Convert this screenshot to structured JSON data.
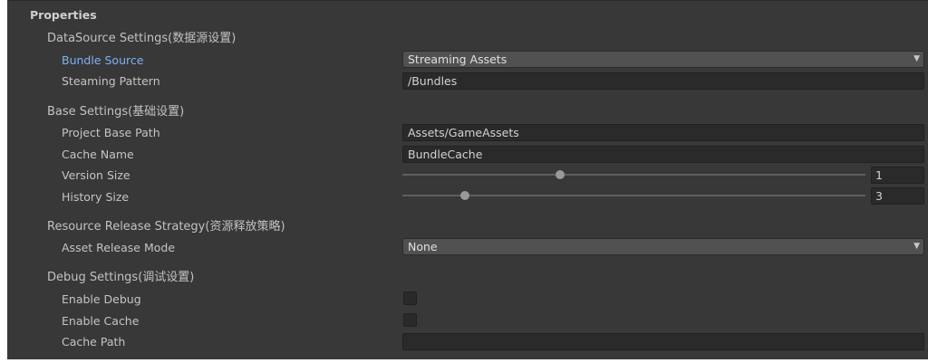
{
  "header": {
    "title": "Properties"
  },
  "datasource": {
    "title": "DataSource Settings(数据源设置)",
    "bundle_source_label": "Bundle Source",
    "bundle_source_value": "Streaming Assets",
    "steaming_pattern_label": "Steaming Pattern",
    "steaming_pattern_value": "/Bundles"
  },
  "base": {
    "title": "Base Settings(基础设置)",
    "project_base_path_label": "Project Base Path",
    "project_base_path_value": "Assets/GameAssets",
    "cache_name_label": "Cache Name",
    "cache_name_value": "BundleCache",
    "version_size_label": "Version Size",
    "version_size_value": "1",
    "version_size_fraction": 0.34,
    "history_size_label": "History Size",
    "history_size_value": "3",
    "history_size_fraction": 0.135
  },
  "release": {
    "title": "Resource Release Strategy(资源释放策略)",
    "asset_release_mode_label": "Asset Release Mode",
    "asset_release_mode_value": "None"
  },
  "debug": {
    "title": "Debug Settings(调试设置)",
    "enable_debug_label": "Enable Debug",
    "enable_debug_checked": false,
    "enable_cache_label": "Enable Cache",
    "enable_cache_checked": false,
    "cache_path_label": "Cache Path",
    "cache_path_value": ""
  },
  "colors": {
    "panel_bg": "#383838",
    "field_bg": "#2a2a2a",
    "dropdown_bg": "#515151",
    "active_label": "#7fb0f5"
  },
  "icons": {
    "dropdown_arrow": "triangle-down-icon",
    "slider_thumb": "circle-thumb"
  }
}
